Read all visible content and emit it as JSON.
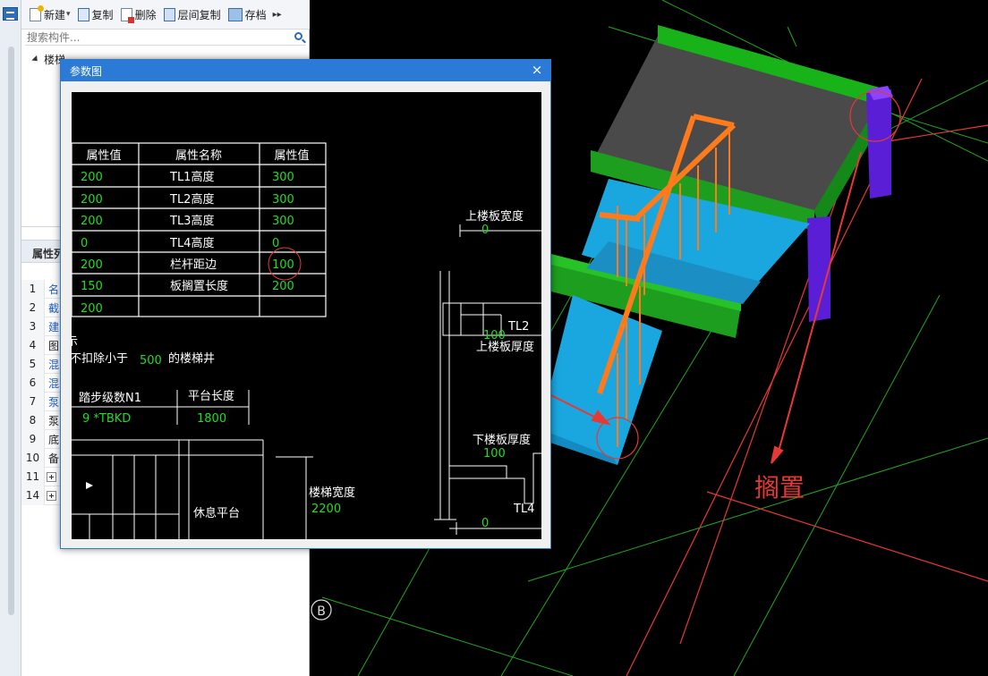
{
  "toolbar": {
    "new_label": "新建",
    "copy_label": "复制",
    "delete_label": "删除",
    "floor_copy_label": "层间复制",
    "save_label": "存档"
  },
  "search": {
    "placeholder": "搜索构件..."
  },
  "tree": {
    "root_label": "楼梯"
  },
  "props": {
    "header": "属性列",
    "rows": [
      {
        "num": "1",
        "name": "名"
      },
      {
        "num": "2",
        "name": "截"
      },
      {
        "num": "3",
        "name": "建"
      },
      {
        "num": "4",
        "name": "图"
      },
      {
        "num": "5",
        "name": "混"
      },
      {
        "num": "6",
        "name": "混"
      },
      {
        "num": "7",
        "name": "泵"
      },
      {
        "num": "8",
        "name": "泵"
      },
      {
        "num": "9",
        "name": "底"
      },
      {
        "num": "10",
        "name": "备"
      },
      {
        "num": "11",
        "name": ""
      },
      {
        "num": "14",
        "name": ""
      }
    ]
  },
  "dialog": {
    "title": "参数图",
    "close": "×",
    "table": {
      "headers": [
        "属性值",
        "属性名称",
        "属性值"
      ],
      "rows": [
        [
          "200",
          "TL1高度",
          "300"
        ],
        [
          "200",
          "TL2高度",
          "300"
        ],
        [
          "200",
          "TL3高度",
          "300"
        ],
        [
          "0",
          "TL4高度",
          "0"
        ],
        [
          "200",
          "栏杆距边",
          "100"
        ],
        [
          "150",
          "板搁置长度",
          "200"
        ],
        [
          "200",
          "",
          ""
        ]
      ]
    },
    "texts": {
      "stair_well_prefix": "不扣除小于",
      "stair_well_value": "500",
      "stair_well_suffix": "的楼梯井",
      "clipped_char": "示",
      "steps_label": "踏步级数N1",
      "steps_value": "9 *TBKD",
      "platform_length_label": "平台长度",
      "platform_length_value": "1800",
      "rest_platform": "休息平台",
      "stair_width_label": "楼梯宽度",
      "stair_width_value": "2200",
      "upper_slab_width_label": "上楼板宽度",
      "upper_slab_width_value": "0",
      "tl2_label": "TL2",
      "upper_slab_thick_value": "100",
      "upper_slab_thick_label": "上楼板厚度",
      "lower_slab_thick_label": "下楼板厚度",
      "lower_slab_thick_value": "100",
      "tl4_label": "TL4",
      "bottom_value": "0"
    }
  },
  "viewport": {
    "annotation": "搁置",
    "axis_label": "B"
  },
  "colors": {
    "accent": "#2b7bd6",
    "annotation": "#e53935",
    "cad_value": "#22dd22"
  }
}
